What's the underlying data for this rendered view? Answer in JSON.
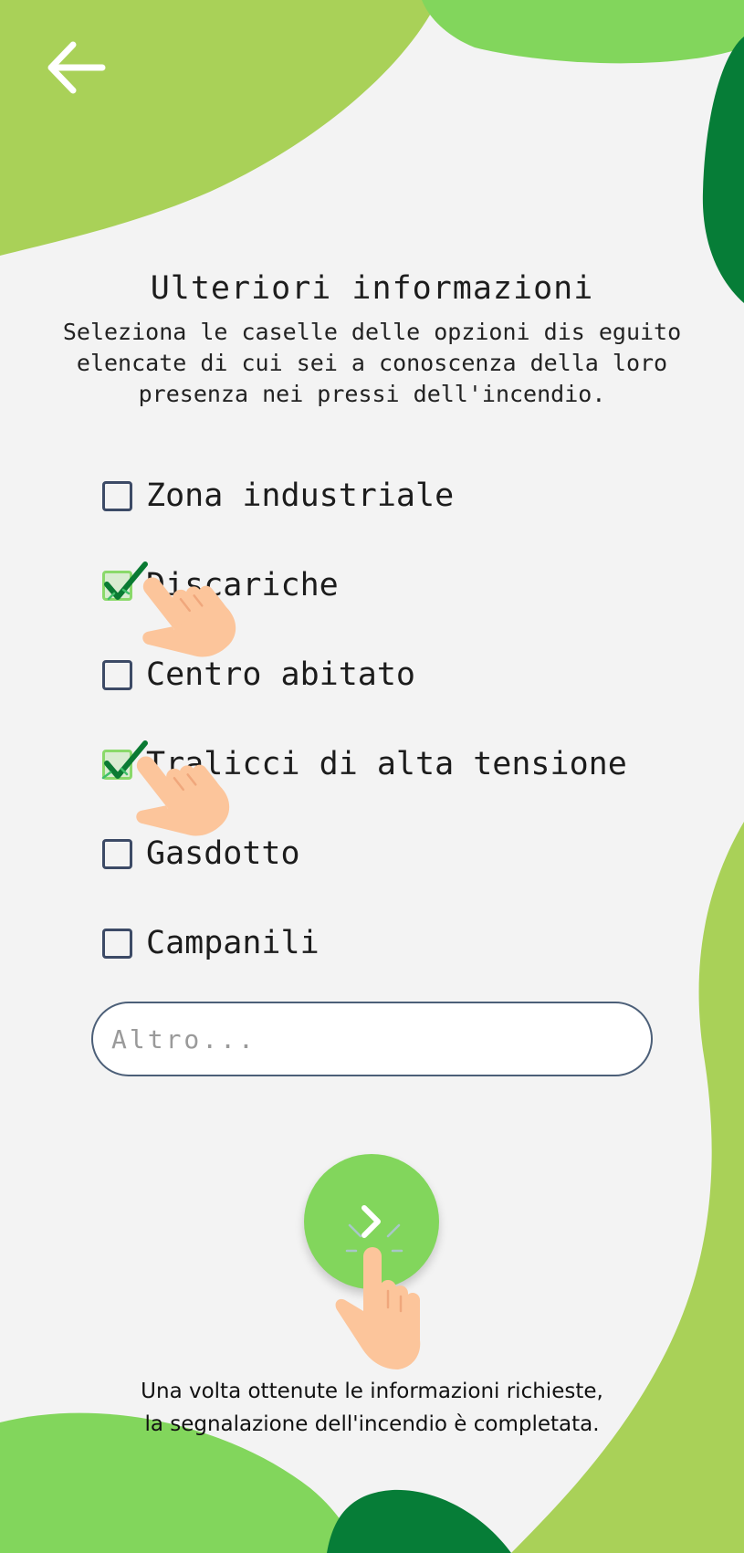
{
  "header": {
    "back_icon": "arrow-left-icon"
  },
  "title": "Ulteriori informazioni",
  "subtitle_lines": [
    "Seleziona le caselle delle opzioni dis eguito",
    "elencate di cui sei a conoscenza della loro",
    "presenza nei pressi dell'incendio."
  ],
  "options": [
    {
      "label": "Zona industriale",
      "checked": false
    },
    {
      "label": "Discariche",
      "checked": true
    },
    {
      "label": "Centro abitato",
      "checked": false
    },
    {
      "label": "Tralicci di alta tensione",
      "checked": true
    },
    {
      "label": "Gasdotto",
      "checked": false
    },
    {
      "label": "Campanili",
      "checked": false
    }
  ],
  "other_field": {
    "placeholder": "Altro...",
    "value": ""
  },
  "next_button": {
    "icon": "chevron-right-icon"
  },
  "tutorial_caption": [
    "Una volta ottenute le informazioni richieste,",
    "la segnalazione dell'incendio è completata."
  ],
  "colors": {
    "light_green": "#a9d158",
    "bright_green": "#82d65c",
    "dark_green": "#067d37",
    "checkbox_border": "#3c4a66",
    "tick": "#0a7a33",
    "hand_skin": "#fcc59b",
    "background": "#f3f3f3"
  }
}
